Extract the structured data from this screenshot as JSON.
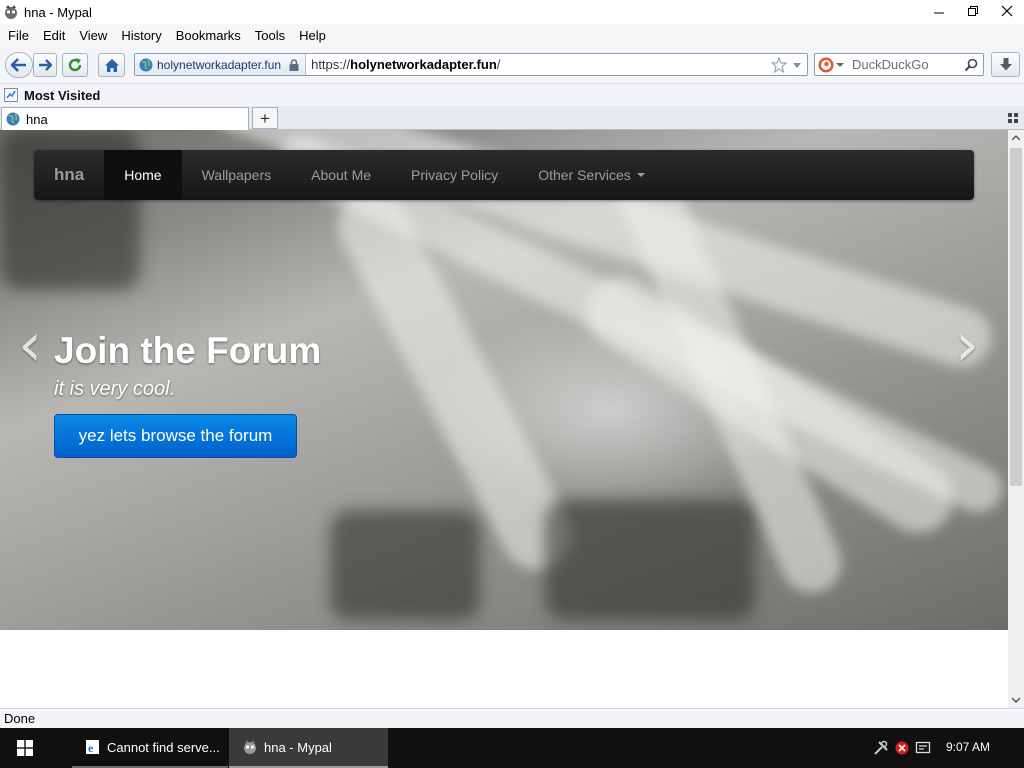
{
  "window": {
    "title": "hna - Mypal"
  },
  "menu": [
    "File",
    "Edit",
    "View",
    "History",
    "Bookmarks",
    "Tools",
    "Help"
  ],
  "urlbar": {
    "identity": "holynetworkadapter.fun",
    "url_prefix": "https://",
    "url_host": "holynetworkadapter.fun",
    "url_suffix": "/"
  },
  "search": {
    "placeholder": "DuckDuckGo"
  },
  "bookmarks": {
    "most_visited": "Most Visited"
  },
  "tabs": [
    {
      "label": "hna"
    }
  ],
  "newtab_label": "+",
  "site": {
    "brand": "hna",
    "nav": [
      "Home",
      "Wallpapers",
      "About Me",
      "Privacy Policy",
      "Other Services"
    ],
    "carousel_prev": "‹",
    "carousel_next": "›",
    "caption_title": "Join the Forum",
    "caption_subtitle": "it is very cool.",
    "cta_label": "yez lets browse the forum"
  },
  "status": "Done",
  "taskbar": {
    "tasks": [
      {
        "label": "Cannot find serve..."
      },
      {
        "label": "hna - Mypal"
      }
    ],
    "clock": "9:07 AM"
  },
  "colors": {
    "accent": "#0a7fe0",
    "nav_bg": "#1d1d1d",
    "taskbar_bg": "#101010"
  }
}
